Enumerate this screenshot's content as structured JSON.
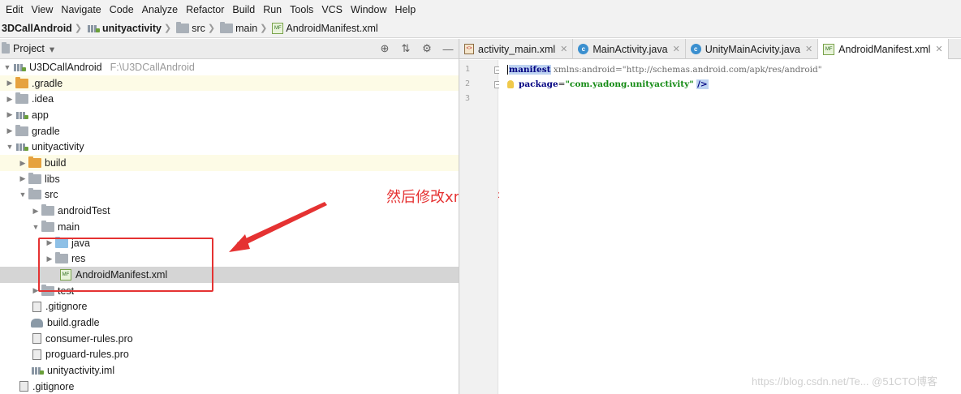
{
  "menu": [
    "Edit",
    "View",
    "Navigate",
    "Code",
    "Analyze",
    "Refactor",
    "Build",
    "Run",
    "Tools",
    "VCS",
    "Window",
    "Help"
  ],
  "breadcrumb": [
    "3DCallAndroid",
    "unityactivity",
    "src",
    "main",
    "AndroidManifest.xml"
  ],
  "project_panel": {
    "title": "Project",
    "dropdown_arrow": "▾",
    "tools": [
      "⊕",
      "⇅",
      "⚙",
      "—"
    ]
  },
  "tree": {
    "root": {
      "label": "U3DCallAndroid",
      "path": "F:\\U3DCallAndroid"
    },
    "items": [
      {
        "label": ".gradle"
      },
      {
        "label": ".idea"
      },
      {
        "label": "app"
      },
      {
        "label": "gradle"
      },
      {
        "label": "unityactivity"
      },
      {
        "label": "build"
      },
      {
        "label": "libs"
      },
      {
        "label": "src"
      },
      {
        "label": "androidTest"
      },
      {
        "label": "main"
      },
      {
        "label": "java"
      },
      {
        "label": "res"
      },
      {
        "label": "AndroidManifest.xml"
      },
      {
        "label": "test"
      },
      {
        "label": ".gitignore"
      },
      {
        "label": "build.gradle"
      },
      {
        "label": "consumer-rules.pro"
      },
      {
        "label": "proguard-rules.pro"
      },
      {
        "label": "unityactivity.iml"
      },
      {
        "label": ".gitignore"
      }
    ]
  },
  "annotation": "然后修改xml文件",
  "tabs": [
    {
      "label": "activity_main.xml"
    },
    {
      "label": "MainActivity.java"
    },
    {
      "label": "UnityMainAcivity.java"
    },
    {
      "label": "AndroidManifest.xml"
    }
  ],
  "icons": {
    "class_letter": "c",
    "manifest_letters": "MF",
    "xml_letters": "<>"
  },
  "editor": {
    "line_numbers": [
      "1",
      "2",
      "3"
    ],
    "line1": {
      "tag": "manifest",
      "attr_prefix": "xmlns:",
      "attr_name": "android",
      "eq": "=",
      "value": "\"http://schemas.android.com/apk/res/android\""
    },
    "line2": {
      "attr": "package",
      "eq": "=",
      "value": "\"com.yadong.unityactivity\"",
      "end": "/>"
    }
  },
  "watermark": "https://blog.csdn.net/Te... @51CTO博客"
}
